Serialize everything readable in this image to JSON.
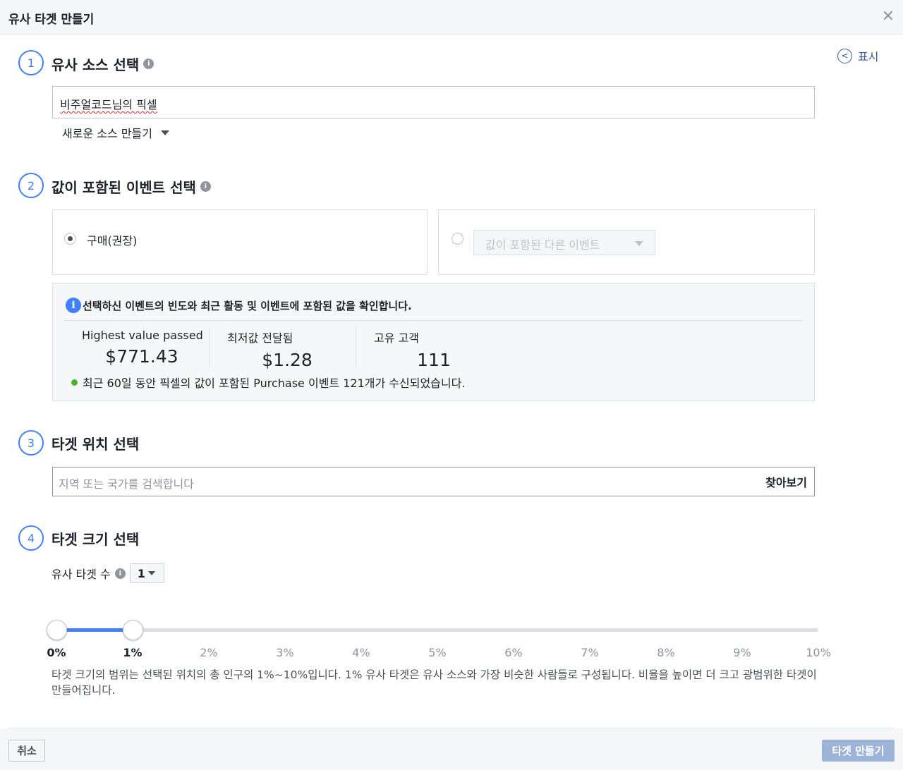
{
  "header": {
    "title": "유사 타겟 만들기",
    "close_icon": "close-icon"
  },
  "show_link": {
    "label": "표시",
    "icon": "chevron-left-icon"
  },
  "step1": {
    "number": "1",
    "title": "유사 소스 선택",
    "source_value": "비주얼코드님의 픽셀",
    "new_source_label": "새로운 소스 만들기"
  },
  "step2": {
    "number": "2",
    "title": "값이 포함된 이벤트 선택",
    "option_purchase": "구매(권장)",
    "option_other_placeholder": "값이 포함된 다른 이벤트",
    "stats": {
      "heading": "선택하신 이벤트의 빈도와 최근 활동 및 이벤트에 포함된 값을 확인합니다.",
      "highest_label": "Highest value passed",
      "highest_value": "$771.43",
      "lowest_label": "최저값 전달됨",
      "lowest_value": "$1.28",
      "unique_label": "고유 고객",
      "unique_value": "111",
      "footer": "최근 60일 동안 픽셀의 값이 포함된 Purchase 이벤트 121개가 수신되었습니다."
    }
  },
  "step3": {
    "number": "3",
    "title": "타겟 위치 선택",
    "location_placeholder": "지역 또는 국가를 검색합니다",
    "browse_label": "찾아보기"
  },
  "step4": {
    "number": "4",
    "title": "타겟 크기 선택",
    "count_label": "유사 타겟 수",
    "count_value": "1",
    "range_start_percent": 0,
    "range_end_percent": 1,
    "ticks": [
      "0%",
      "1%",
      "2%",
      "3%",
      "4%",
      "5%",
      "6%",
      "7%",
      "8%",
      "9%",
      "10%"
    ],
    "description": "타겟 크기의 범위는 선택된 위치의 총 인구의 1%~10%입니다. 1% 유사 타겟은 유사 소스와 가장 비슷한 사람들로 구성됩니다. 비율을 높이면 더 크고 광범위한 타겟이 만들어집니다."
  },
  "footer": {
    "cancel_label": "취소",
    "create_label": "타겟 만들기"
  },
  "colors": {
    "accent": "#4080ff",
    "create_disabled": "#9cb4d8",
    "status_green": "#42b72a"
  }
}
